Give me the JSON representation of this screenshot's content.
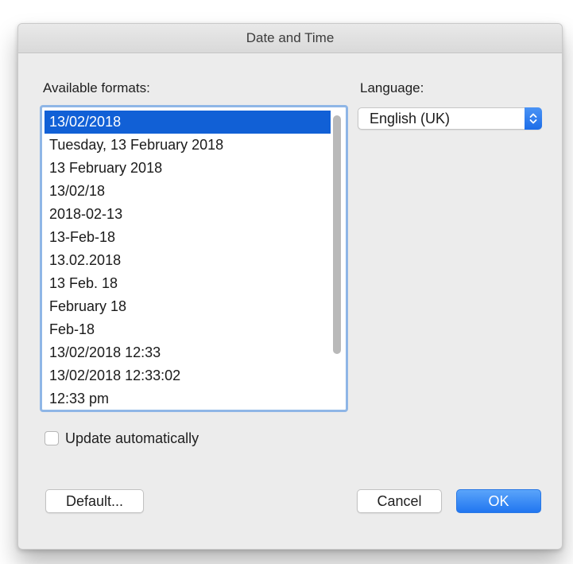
{
  "window": {
    "title": "Date and Time"
  },
  "formats": {
    "label": "Available formats:",
    "items": [
      "13/02/2018",
      "Tuesday, 13 February 2018",
      "13 February 2018",
      "13/02/18",
      "2018-02-13",
      "13-Feb-18",
      "13.02.2018",
      "13 Feb. 18",
      "February 18",
      "Feb-18",
      "13/02/2018 12:33",
      "13/02/2018 12:33:02",
      "12:33 pm"
    ],
    "selected_index": 0
  },
  "language": {
    "label": "Language:",
    "selected": "English (UK)"
  },
  "update_automatically": {
    "label": "Update automatically",
    "checked": false
  },
  "buttons": {
    "default_label": "Default...",
    "cancel_label": "Cancel",
    "ok_label": "OK"
  },
  "colors": {
    "accent": "#1160d6",
    "focus_ring": "#8fb6e6",
    "dialog_bg": "#ececec"
  },
  "icons": {
    "select_arrows": "chevron-up-down-icon"
  }
}
